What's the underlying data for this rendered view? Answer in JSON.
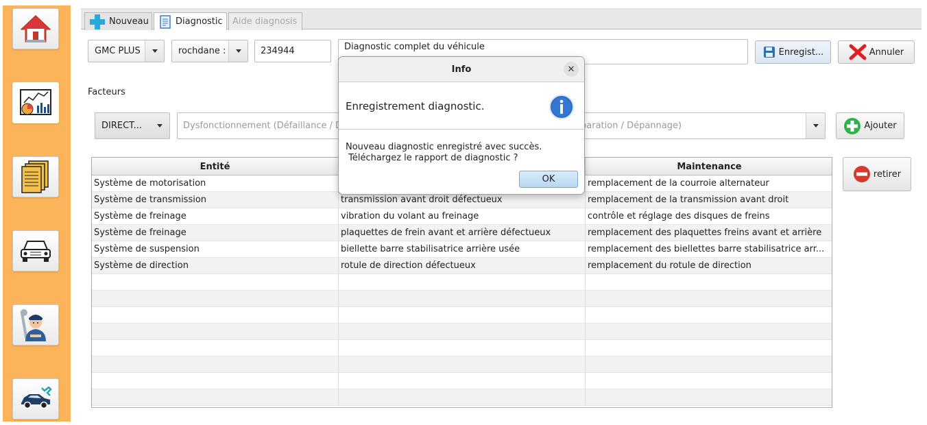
{
  "sidebar": {
    "items": [
      {
        "name": "home",
        "icon": "home-icon"
      },
      {
        "name": "diagnostic",
        "icon": "analytics-icon"
      },
      {
        "name": "documents",
        "icon": "documents-icon"
      },
      {
        "name": "vehicles",
        "icon": "car-icon"
      },
      {
        "name": "mechanics",
        "icon": "mechanic-icon"
      },
      {
        "name": "repair",
        "icon": "car-repair-icon"
      }
    ],
    "accent_color": "#fcb45a"
  },
  "tabs": [
    {
      "label": "Nouveau",
      "icon": "plus-icon",
      "state": "normal"
    },
    {
      "label": "Diagnostic",
      "icon": "document-icon",
      "state": "selected"
    },
    {
      "label": "Aide diagnosis",
      "state": "disabled"
    }
  ],
  "top_row": {
    "vehicle_select": "GMC PLUS",
    "client_select": "rochdane :",
    "mileage_value": "234944",
    "description_value": "Diagnostic complet du véhicule",
    "save_label": "Enregist...",
    "cancel_label": "Annuler"
  },
  "factors": {
    "label": "Facteurs",
    "entity_select": "DIRECT...",
    "symptom_placeholder": "Dysfonctionnement (Défaillance / D",
    "repair_placeholder": "paration / Dépannage)",
    "add_label": "Ajouter"
  },
  "remove_label": "retirer",
  "table": {
    "headers": [
      "Entité",
      "",
      "Maintenance"
    ],
    "rows": [
      [
        "Système de motorisation",
        "",
        "remplacement de la courroie alternateur"
      ],
      [
        "Système de transmission",
        "transmission avant droit défectueux",
        "remplacement de la transmission avant droit"
      ],
      [
        "Système de freinage",
        "vibration du volant au freinage",
        "contrôle et réglage des disques de freins"
      ],
      [
        "Système de freinage",
        "plaquettes de frein avant et arrière défectueux",
        "remplacement des plaquettes freins avant et arrière"
      ],
      [
        "Système de suspension",
        "biellette barre stabilisatrice arrière usée",
        "remplacement des biellettes barre stabilisatrice arr..."
      ],
      [
        "Système de direction",
        "rotule de direction défectueux",
        "remplacement du rotule de direction"
      ]
    ]
  },
  "dialog": {
    "title": "Info",
    "header_text": "Enregistrement diagnostic.",
    "message": "Nouveau diagnostic enregistré avec succès.\n Téléchargez le rapport de diagnostic ?",
    "ok_label": "OK",
    "icon": "info-icon"
  }
}
